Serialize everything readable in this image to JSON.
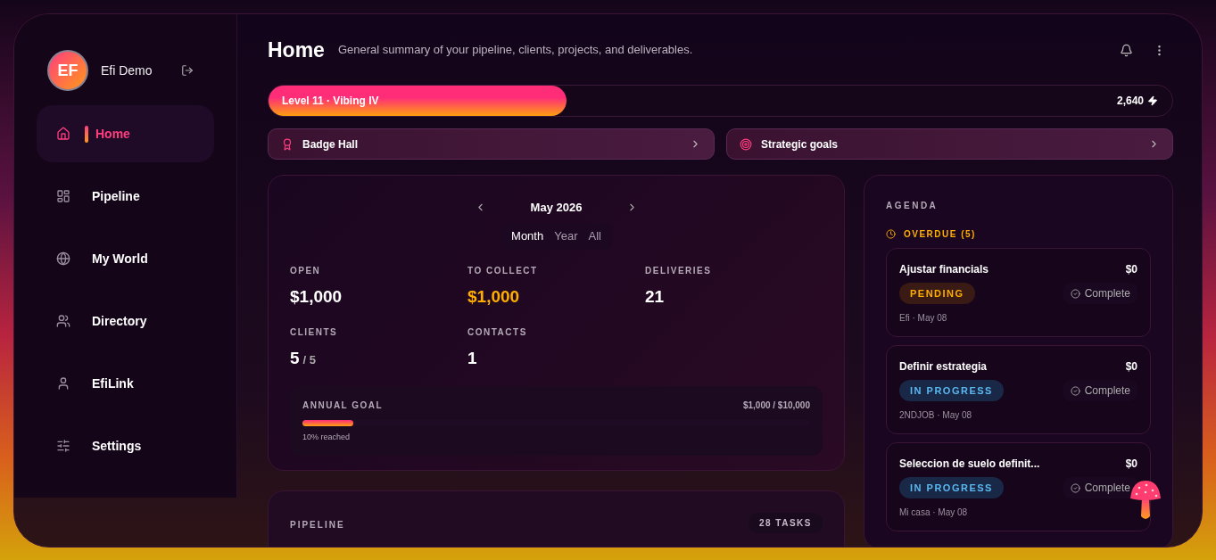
{
  "user": {
    "initials": "EF",
    "name": "Efi Demo"
  },
  "sidebar": {
    "items": [
      {
        "label": "Home",
        "selected": true
      },
      {
        "label": "Pipeline",
        "selected": false
      },
      {
        "label": "My World",
        "selected": false
      },
      {
        "label": "Directory",
        "selected": false
      },
      {
        "label": "EfiLink",
        "selected": false
      },
      {
        "label": "Settings",
        "selected": false
      }
    ]
  },
  "header": {
    "title": "Home",
    "subtitle": "General summary of your pipeline, clients, projects, and deliverables."
  },
  "level_bar": {
    "label": "Level 11 · Vibing IV",
    "level": 0.33,
    "points": "2,640"
  },
  "shortcuts": [
    {
      "label": "Badge Hall"
    },
    {
      "label": "Strategic goals"
    }
  ],
  "summary": {
    "period": "May 2026",
    "tabs": [
      {
        "label": "Month",
        "selected": true
      },
      {
        "label": "Year",
        "selected": false
      },
      {
        "label": "All",
        "selected": false
      }
    ],
    "stats": [
      {
        "label": "OPEN",
        "value": "$1,000",
        "highlight": false
      },
      {
        "label": "TO COLLECT",
        "value": "$1,000",
        "highlight": true
      },
      {
        "label": "DELIVERIES",
        "value": "21",
        "highlight": false
      },
      {
        "label": "CLIENTS",
        "value": "5",
        "suffix": "/ 5",
        "highlight": false
      },
      {
        "label": "CONTACTS",
        "value": "1",
        "highlight": false
      }
    ],
    "annual_goal": {
      "label": "ANNUAL GOAL",
      "amount": "$1,000 / $10,000",
      "level": 0.1,
      "caption": "10% reached"
    }
  },
  "pipeline": {
    "title": "PIPELINE",
    "count": "28 TASKS"
  },
  "agenda": {
    "title": "AGENDA",
    "section": "OVERDUE (5)",
    "items": [
      {
        "title": "Ajustar financials",
        "amount": "$0",
        "status": "PENDING",
        "kind": "pending",
        "action": "Complete",
        "meta": "Efi · May 08"
      },
      {
        "title": "Definir estrategia",
        "amount": "$0",
        "status": "IN PROGRESS",
        "kind": "in_progress",
        "action": "Complete",
        "meta": "2NDJOB · May 08"
      },
      {
        "title": "Seleccion de suelo definit...",
        "amount": "$0",
        "status": "IN PROGRESS",
        "kind": "in_progress",
        "action": "Complete",
        "meta": "Mi casa · May 08"
      }
    ]
  }
}
